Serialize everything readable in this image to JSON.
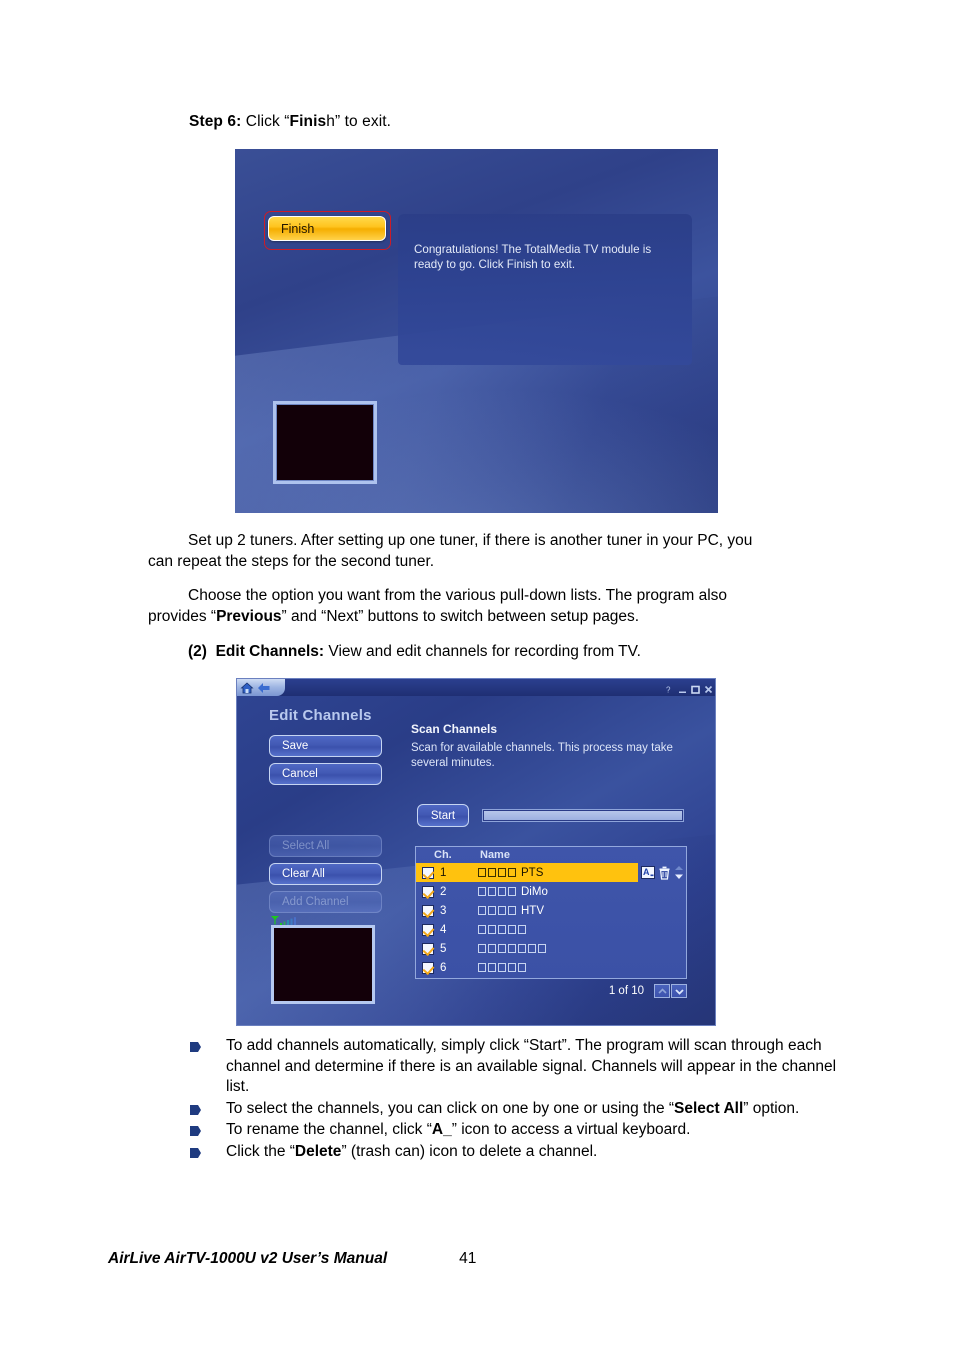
{
  "document": {
    "step_heading_bold": "Step 6:",
    "step_heading_rest_a": " Click “",
    "step_heading_bold2": "Finis",
    "step_heading_rest_b": "h” to exit.",
    "para1": "Set up 2 tuners. After setting up one tuner, if there is another tuner in your PC, you can repeat the steps for the second tuner.",
    "para2_a": "Choose the option you want from the various pull-down lists. The program also provides “",
    "para2_bold": "Previous",
    "para2_b": "” and “Next” buttons to switch between setup pages.",
    "para3_num": "(2)",
    "para3_bold": "Edit Channels:",
    "para3_rest": " View and edit channels for recording from TV.",
    "bullets": [
      {
        "pre": "To add channels automatically, simply click “Start”. The program will scan through each channel and determine if there is an available signal. Channels will appear in the channel list.",
        "bold": "",
        "post": ""
      },
      {
        "pre": "To select the channels, you can click on one by one or using the “",
        "bold": "Select All",
        "post": "” option."
      },
      {
        "pre": "To rename the channel, click “",
        "bold": "A_",
        "post": "” icon to access a virtual keyboard."
      },
      {
        "pre": "Click the “",
        "bold": "Delete",
        "post": "” (trash can) icon to delete a channel."
      }
    ],
    "footer_title": "AirLive AirTV-1000U v2 User’s Manual",
    "footer_page": "41"
  },
  "screenshot_finish": {
    "finish_button_label": "Finish",
    "message": "Congratulations! The TotalMedia TV module is ready to go. Click Finish to exit.",
    "highlight_color": "#cc1c28",
    "button_color": "#ffc41f"
  },
  "screenshot_edit_channels": {
    "window_title": "Edit Channels",
    "titlebar_icons": [
      "home-icon",
      "back-arrow-icon"
    ],
    "window_controls": [
      "help-icon",
      "minimize-icon",
      "maximize-icon",
      "close-icon"
    ],
    "side_buttons": [
      {
        "label": "Save",
        "enabled": true
      },
      {
        "label": "Cancel",
        "enabled": true
      },
      {
        "label": "Select All",
        "enabled": false
      },
      {
        "label": "Clear All",
        "enabled": true
      },
      {
        "label": "Add Channel",
        "enabled": false
      }
    ],
    "scan": {
      "title": "Scan Channels",
      "description": "Scan for available channels. This process may take several minutes.",
      "start_label": "Start",
      "progress_percent": 0
    },
    "table": {
      "headers": [
        "Ch.",
        "Name"
      ],
      "rows": [
        {
          "checked": true,
          "ch": "1",
          "boxes": 4,
          "name": "PTS",
          "selected": true
        },
        {
          "checked": true,
          "ch": "2",
          "boxes": 4,
          "name": "DiMo",
          "selected": false
        },
        {
          "checked": true,
          "ch": "3",
          "boxes": 4,
          "name": "HTV",
          "selected": false
        },
        {
          "checked": true,
          "ch": "4",
          "boxes": 5,
          "name": "",
          "selected": false
        },
        {
          "checked": true,
          "ch": "5",
          "boxes": 7,
          "name": "",
          "selected": false
        },
        {
          "checked": true,
          "ch": "6",
          "boxes": 5,
          "name": "",
          "selected": false
        }
      ],
      "row_action_icons": [
        "rename-keyboard-icon",
        "trash-delete-icon",
        "move-up-down-icon"
      ],
      "selected_row_color": "#ffc20e"
    },
    "pager": {
      "label": "1 of 10",
      "up_icon": "chevron-up-icon",
      "down_icon": "chevron-down-icon"
    },
    "signal_indicator": "signal-strength-icon",
    "preview_label": "video-preview"
  }
}
